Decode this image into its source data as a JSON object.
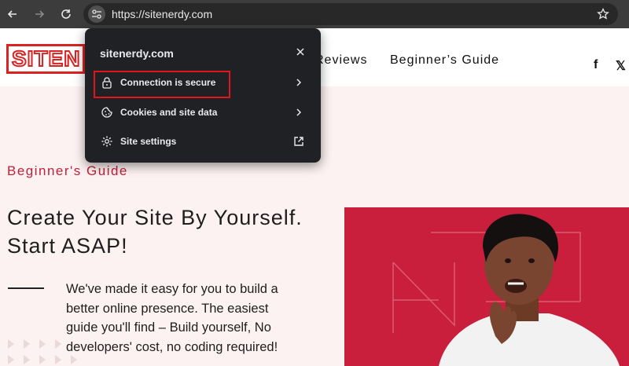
{
  "browser": {
    "url": "https://sitenerdy.com",
    "icons": {
      "back": "back-arrow-icon",
      "forward": "forward-arrow-icon",
      "reload": "reload-icon",
      "site_info": "tune-icon",
      "bookmark": "star-icon"
    }
  },
  "site": {
    "logo_text": "SITEN",
    "nav": [
      "Reviews",
      "Beginner’s Guide"
    ],
    "social": [
      "f",
      "𝕏"
    ],
    "category": "Beginner's Guide",
    "hero_title": "Create Your Site By Yourself. Start ASAP!",
    "hero_text": "We've made it easy for you to build a better online presence. The easiest guide you'll find – Build yourself, No developers' cost, no coding required!",
    "accent_color": "#c91f3c"
  },
  "popup": {
    "title": "sitenerdy.com",
    "items": [
      {
        "label": "Connection is secure",
        "icon": "lock-icon",
        "trail": "chevron-right-icon"
      },
      {
        "label": "Cookies and site data",
        "icon": "cookie-icon",
        "trail": "chevron-right-icon"
      },
      {
        "label": "Site settings",
        "icon": "gear-icon",
        "trail": "external-link-icon"
      }
    ]
  }
}
